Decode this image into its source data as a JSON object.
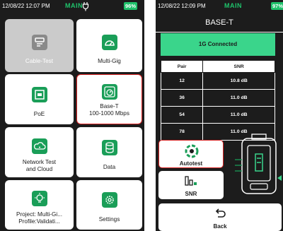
{
  "left": {
    "status": {
      "time": "12/08/22 12:07 PM",
      "mode": "MAIN",
      "battery": "96%"
    },
    "tiles": [
      {
        "label": "Cable-Test",
        "icon": "cable-icon"
      },
      {
        "label": "Multi-Gig",
        "icon": "speedometer-icon"
      },
      {
        "label": "PoE",
        "icon": "poe-port-icon"
      },
      {
        "label_line1": "Base-T",
        "label_line2": "100-1000 Mbps",
        "icon": "gauge-icon"
      },
      {
        "label_line1": "Network Test",
        "label_line2": "and Cloud",
        "icon": "cloud-wifi-icon"
      },
      {
        "label": "Data",
        "icon": "database-icon"
      },
      {
        "label_line1": "Project: Multi-Gi...",
        "label_line2": "Profile:Validati...",
        "icon": "lightbulb-icon"
      },
      {
        "label": "Settings",
        "icon": "gear-icon"
      }
    ]
  },
  "right": {
    "status": {
      "time": "12/08/22 12:09 PM",
      "mode": "MAIN",
      "battery": "97%"
    },
    "title": "BASE-T",
    "banner": "1G Connected",
    "table": {
      "headers": [
        "Pair",
        "SNR"
      ],
      "rows": [
        {
          "pair": "12",
          "snr": "10.8 dB"
        },
        {
          "pair": "36",
          "snr": "11.0 dB"
        },
        {
          "pair": "54",
          "snr": "11.0 dB"
        },
        {
          "pair": "78",
          "snr": "11.0 dB"
        }
      ]
    },
    "buttons": {
      "autotest": "Autotest",
      "snr": "SNR",
      "back": "Back"
    }
  },
  "colors": {
    "accent": "#1a9e58",
    "banner": "#3ad58b",
    "highlight": "#d92323",
    "background": "#1c1c1c"
  }
}
